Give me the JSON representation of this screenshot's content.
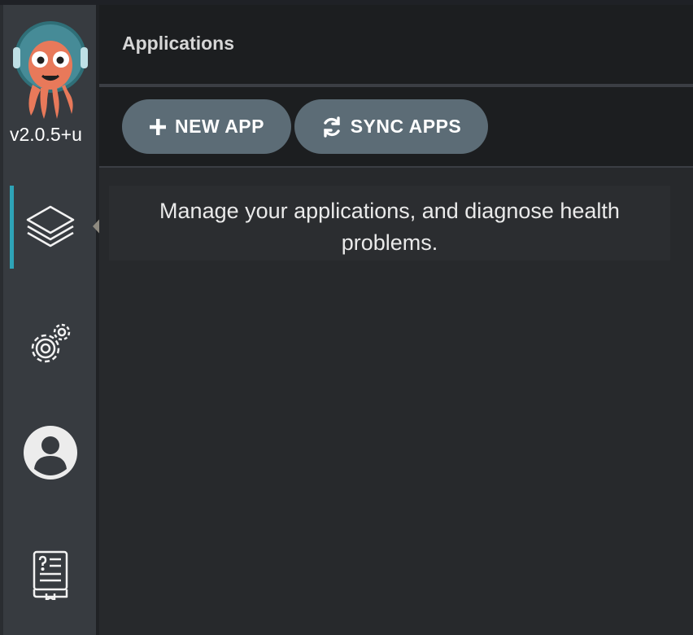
{
  "app": {
    "version": "v2.0.5+u",
    "logo_icon": "argo-octopus-logo"
  },
  "sidebar": {
    "items": [
      {
        "name": "applications",
        "icon": "layers-icon",
        "active": true
      },
      {
        "name": "settings",
        "icon": "settings-gears-icon",
        "active": false
      },
      {
        "name": "user-info",
        "icon": "user-avatar-icon",
        "active": false
      },
      {
        "name": "documentation",
        "icon": "help-book-icon",
        "active": false
      }
    ],
    "active_color": "#2ea3b7"
  },
  "header": {
    "title": "Applications"
  },
  "toolbar": {
    "new_app_label": "NEW APP",
    "new_app_icon": "plus-icon",
    "sync_apps_label": "SYNC APPS",
    "sync_apps_icon": "sync-icon"
  },
  "main": {
    "message": "Manage your applications, and diagnose health problems."
  },
  "colors": {
    "sidebar_bg": "#373b40",
    "header_bg": "#1c1e20",
    "button_bg": "#5c6c76",
    "content_bg": "#27292c"
  }
}
